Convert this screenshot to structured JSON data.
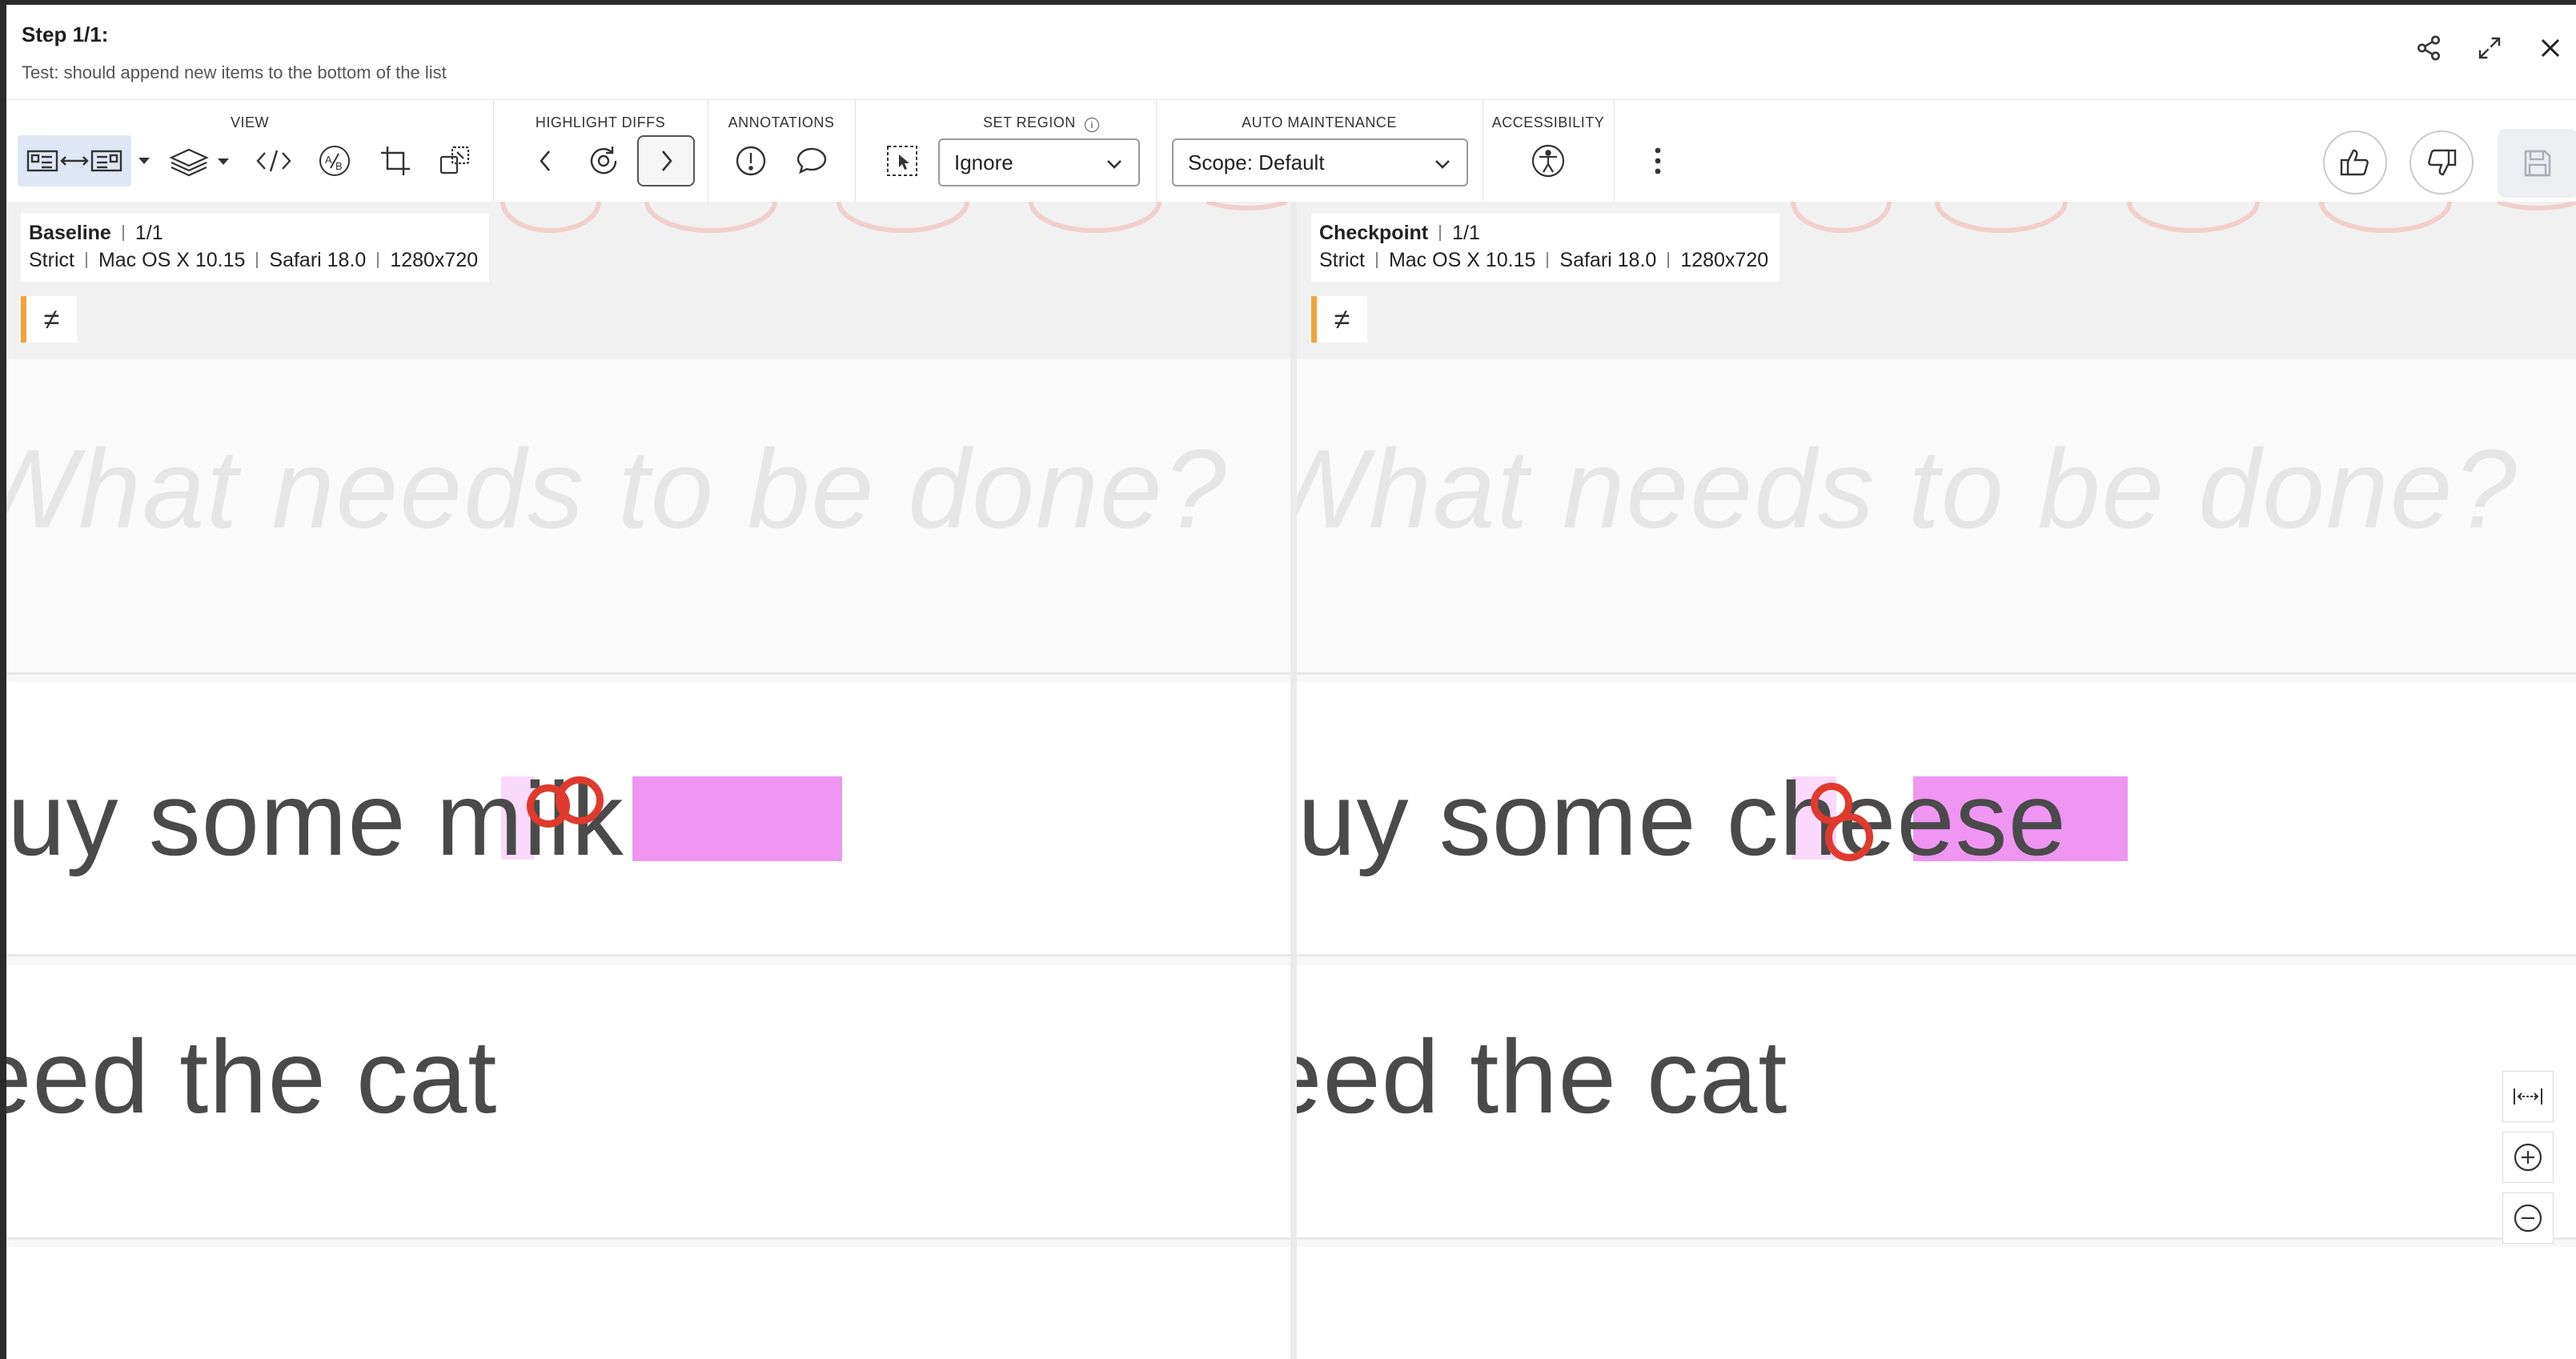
{
  "header": {
    "step_title": "Step 1/1:",
    "test_name": "Test: should append new items to the bottom of the list",
    "icons": [
      "share-icon",
      "expand-icon",
      "close-icon"
    ]
  },
  "toolbar": {
    "view_label": "VIEW",
    "highlight_label": "HIGHLIGHT DIFFS",
    "annotations_label": "ANNOTATIONS",
    "region_label": "SET REGION",
    "region_value": "Ignore",
    "auto_label": "AUTO MAINTENANCE",
    "auto_value": "Scope: Default",
    "accessibility_label": "ACCESSIBILITY"
  },
  "baseline": {
    "title": "Baseline",
    "count": "1/1",
    "match_level": "Strict",
    "os": "Mac OS X 10.15",
    "browser": "Safari 18.0",
    "viewport": "1280x720",
    "diff_symbol": "≠",
    "placeholder": "What needs to be done?",
    "item1": "buy some milk",
    "item2": "feed the cat"
  },
  "checkpoint": {
    "title": "Checkpoint",
    "count": "1/1",
    "match_level": "Strict",
    "os": "Mac OS X 10.15",
    "browser": "Safari 18.0",
    "viewport": "1280x720",
    "diff_symbol": "≠",
    "placeholder": "What needs to be done?",
    "item1": "buy some cheese",
    "item2": "feed the cat"
  },
  "colors": {
    "diff_highlight": "#ee96f2",
    "diff_ring": "#e03a2e",
    "diff_badge_accent": "#f2a33a"
  }
}
